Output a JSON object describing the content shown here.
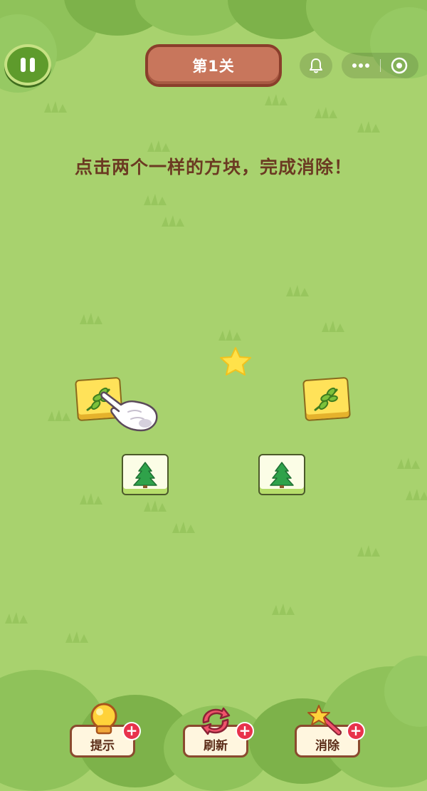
{
  "header": {
    "level_title": "第1关"
  },
  "instruction": "点击两个一样的方块，完成消除！",
  "board": {
    "tiles": [
      {
        "id": "leaf-tile-1",
        "icon": "leaf-icon",
        "style": "yellow"
      },
      {
        "id": "leaf-tile-2",
        "icon": "leaf-icon",
        "style": "yellow"
      },
      {
        "id": "tree-tile-1",
        "icon": "pine-tree-icon",
        "style": "cream"
      },
      {
        "id": "tree-tile-2",
        "icon": "pine-tree-icon",
        "style": "cream"
      }
    ]
  },
  "toolbar": {
    "hint_label": "提示",
    "refresh_label": "刷新",
    "remove_label": "消除"
  },
  "colors": {
    "background": "#a8d26e",
    "title_badge": "#c8765c",
    "instruction_text": "#6b3a22",
    "plus_badge": "#e8324c"
  }
}
